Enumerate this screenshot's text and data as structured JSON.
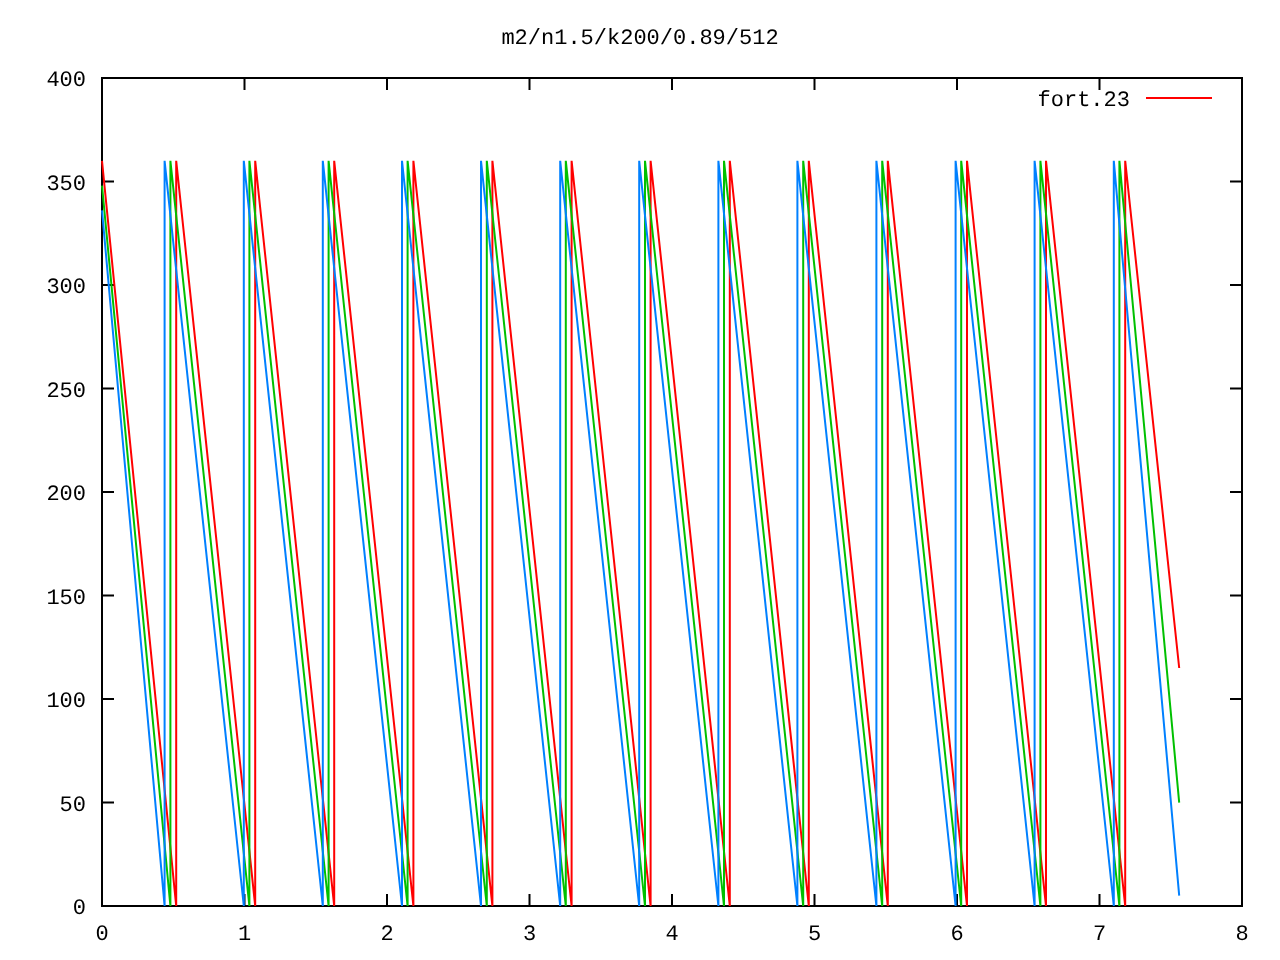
{
  "chart_data": {
    "type": "line",
    "title": "m2/n1.5/k200/0.89/512",
    "xlim": [
      0,
      8
    ],
    "ylim": [
      0,
      400
    ],
    "xticks": [
      0,
      1,
      2,
      3,
      4,
      5,
      6,
      7,
      8
    ],
    "yticks": [
      0,
      50,
      100,
      150,
      200,
      250,
      300,
      350,
      400
    ],
    "series": [
      {
        "name": "fort.23",
        "color": "#ff0000",
        "x": [
          0,
          0.52,
          0.52,
          1.075,
          1.075,
          1.63,
          1.63,
          2.185,
          2.185,
          2.74,
          2.74,
          3.295,
          3.295,
          3.85,
          3.85,
          4.405,
          4.405,
          4.96,
          4.96,
          5.515,
          5.515,
          6.07,
          6.07,
          6.625,
          6.625,
          7.18,
          7.18,
          7.56
        ],
        "values": [
          360,
          0,
          360,
          0,
          360,
          0,
          360,
          0,
          360,
          0,
          360,
          0,
          360,
          0,
          360,
          0,
          360,
          0,
          360,
          0,
          360,
          0,
          360,
          0,
          360,
          0,
          360,
          115
        ]
      },
      {
        "color": "#00c000",
        "x": [
          0,
          0.48,
          0.48,
          1.035,
          1.035,
          1.59,
          1.59,
          2.145,
          2.145,
          2.7,
          2.7,
          3.255,
          3.255,
          3.81,
          3.81,
          4.365,
          4.365,
          4.92,
          4.92,
          5.475,
          5.475,
          6.03,
          6.03,
          6.585,
          6.585,
          7.14,
          7.14,
          7.56
        ],
        "values": [
          348,
          0,
          360,
          0,
          360,
          0,
          360,
          0,
          360,
          0,
          360,
          0,
          360,
          0,
          360,
          0,
          360,
          0,
          360,
          0,
          360,
          0,
          360,
          0,
          360,
          0,
          360,
          50
        ]
      },
      {
        "color": "#0080ff",
        "x": [
          0,
          0.44,
          0.44,
          0.995,
          0.995,
          1.55,
          1.55,
          2.105,
          2.105,
          2.66,
          2.66,
          3.215,
          3.215,
          3.77,
          3.77,
          4.325,
          4.325,
          4.88,
          4.88,
          5.435,
          5.435,
          5.99,
          5.99,
          6.545,
          6.545,
          7.1,
          7.1,
          7.56
        ],
        "values": [
          336,
          0,
          360,
          0,
          360,
          0,
          360,
          0,
          360,
          0,
          360,
          0,
          360,
          0,
          360,
          0,
          360,
          0,
          360,
          0,
          360,
          0,
          360,
          0,
          360,
          0,
          360,
          5
        ]
      }
    ]
  }
}
